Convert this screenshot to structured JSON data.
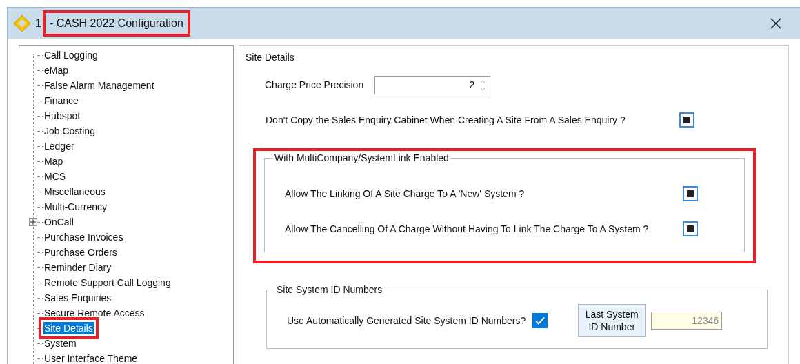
{
  "window": {
    "title_prefix": "1",
    "title": "- CASH 2022 Configuration",
    "title_highlighted": true
  },
  "tree": {
    "items": [
      {
        "label": "Call Logging",
        "selected": false
      },
      {
        "label": "eMap",
        "selected": false
      },
      {
        "label": "False Alarm Management",
        "selected": false
      },
      {
        "label": "Finance",
        "selected": false
      },
      {
        "label": "Hubspot",
        "selected": false
      },
      {
        "label": "Job Costing",
        "selected": false
      },
      {
        "label": "Ledger",
        "selected": false
      },
      {
        "label": "Map",
        "selected": false
      },
      {
        "label": "MCS",
        "selected": false
      },
      {
        "label": "Miscellaneous",
        "selected": false
      },
      {
        "label": "Multi-Currency",
        "selected": false
      },
      {
        "label": "OnCall",
        "selected": false,
        "collapsed": true
      },
      {
        "label": "Purchase Invoices",
        "selected": false
      },
      {
        "label": "Purchase Orders",
        "selected": false
      },
      {
        "label": "Reminder Diary",
        "selected": false
      },
      {
        "label": "Remote Support Call Logging",
        "selected": false
      },
      {
        "label": "Sales Enquiries",
        "selected": false
      },
      {
        "label": "Secure Remote Access",
        "selected": false
      },
      {
        "label": "Site Details",
        "selected": true,
        "highlighted": true
      },
      {
        "label": "System",
        "selected": false
      },
      {
        "label": "User Interface Theme",
        "selected": false
      }
    ]
  },
  "panel": {
    "title": "Site Details",
    "precision": {
      "label": "Charge Price Precision",
      "value": "2"
    },
    "dont_copy": {
      "label": "Don't Copy the Sales Enquiry Cabinet When Creating A Site From A Sales Enquiry ?",
      "indeterminate": true
    },
    "multicompany": {
      "legend": "With MultiCompany/SystemLink Enabled",
      "highlighted": true,
      "options": [
        {
          "label": "Allow The Linking Of A Site Charge To A 'New' System ?",
          "indeterminate": true
        },
        {
          "label": "Allow The Cancelling Of A Charge Without Having To Link The Charge To A System ?",
          "indeterminate": true
        }
      ]
    },
    "id_numbers": {
      "legend": "Site System ID Numbers",
      "auto_label": "Use Automatically Generated Site System ID Numbers?",
      "auto_checked": true,
      "button": "Last System ID Number",
      "last_value": "12346"
    }
  }
}
